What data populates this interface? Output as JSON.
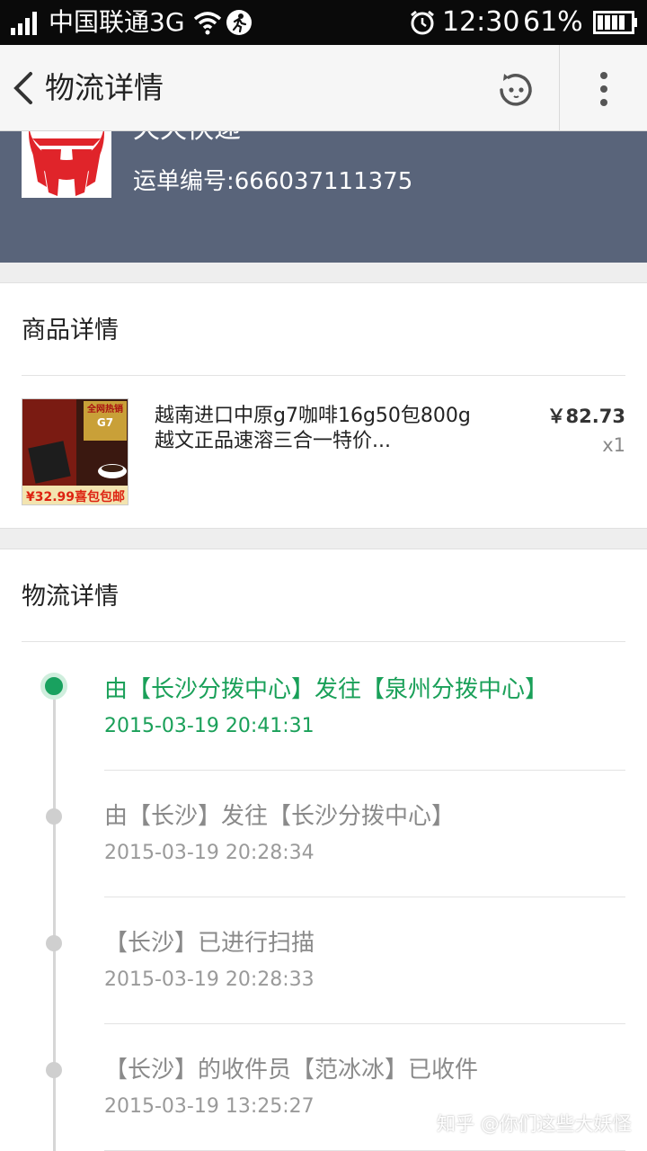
{
  "status_bar": {
    "carrier": "中国联通3G",
    "time": "12:30",
    "battery_pct": "61%"
  },
  "title_bar": {
    "title": "物流详情"
  },
  "courier": {
    "name": "天天快递",
    "tracking": "运单编号:666037111375"
  },
  "goods": {
    "section_title": "商品详情",
    "product_name": "越南进口中原g7咖啡16g50包800g越文正品速溶三合一特价...",
    "price": "￥82.73",
    "quantity": "x1",
    "thumb_text_top": "全网热销",
    "thumb_text_brand": "G7",
    "thumb_price": "¥32.99喜包包邮"
  },
  "logistics": {
    "section_title": "物流详情",
    "events": [
      {
        "text": "由【长沙分拨中心】发往【泉州分拨中心】",
        "time": "2015-03-19 20:41:31",
        "active": true
      },
      {
        "text": "由【长沙】发往【长沙分拨中心】",
        "time": "2015-03-19 20:28:34",
        "active": false
      },
      {
        "text": "【长沙】已进行扫描",
        "time": "2015-03-19 20:28:33",
        "active": false
      },
      {
        "text": "【长沙】的收件员【范冰冰】已收件",
        "time": "2015-03-19 13:25:27",
        "active": false
      }
    ]
  },
  "watermark": "知乎 @你们这些大妖怪",
  "colors": {
    "accent_green": "#1aa059",
    "header_blue": "#59647a"
  }
}
